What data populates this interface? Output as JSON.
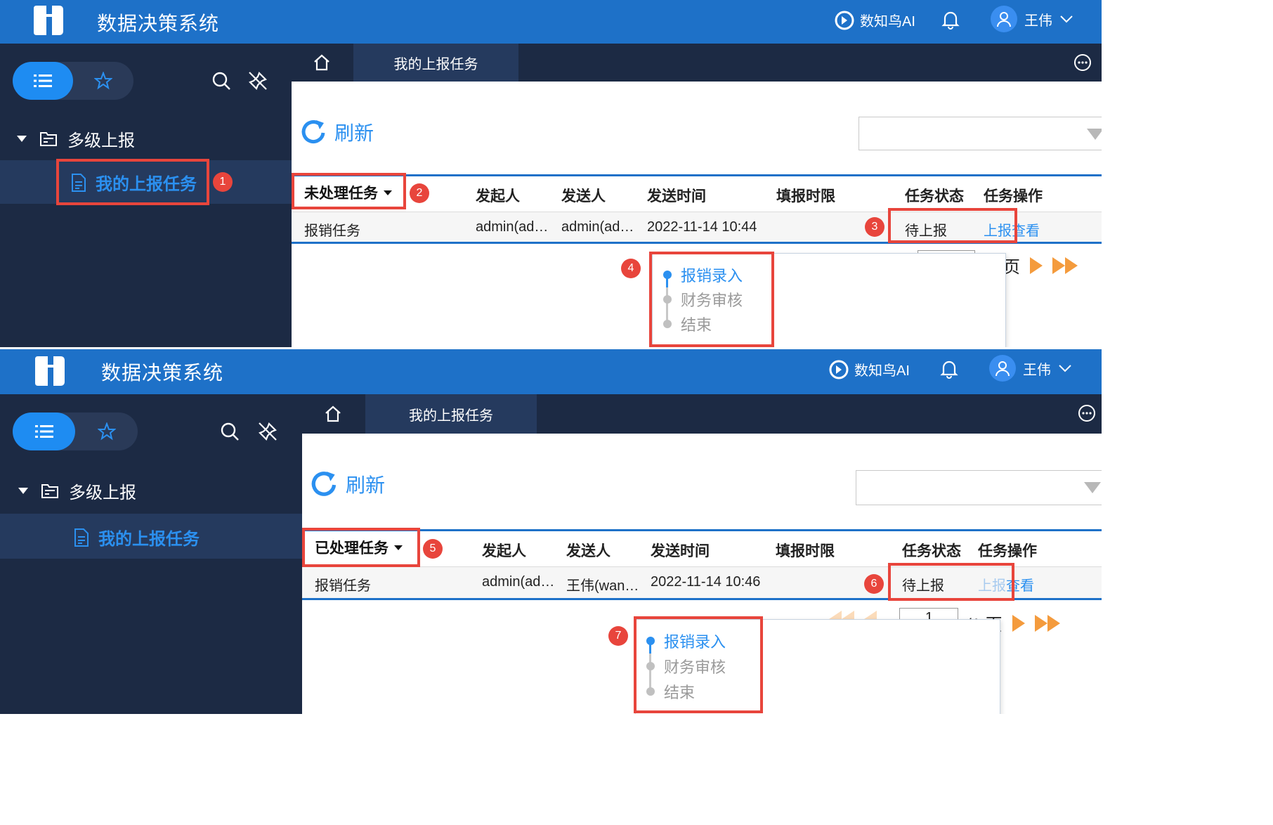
{
  "colors": {
    "topbar": "#1e71c8",
    "sidebar": "#1c2a44",
    "accent": "#2b90f0",
    "highlight": "#e8453c",
    "pager": "#f49b3d"
  },
  "panels": [
    {
      "app_title": "数据决策系统",
      "ai_label": "数知鸟AI",
      "user_name": "王伟",
      "tree_folder": "多级上报",
      "tree_item": "我的上报任务",
      "tab_label": "我的上报任务",
      "refresh_label": "刷新",
      "task_filter": "未处理任务",
      "columns": [
        "发起人",
        "发送人",
        "发送时间",
        "填报时限",
        "任务状态",
        "任务操作"
      ],
      "row": {
        "name": "报销任务",
        "initiator": "admin(ad…",
        "sender": "admin(ad…",
        "time": "2022-11-14 10:44",
        "deadline": "",
        "status": "待上报",
        "action_report": "上报",
        "action_view": "查看"
      },
      "pager_text": "页",
      "steps": [
        {
          "label": "报销录入",
          "state": "active"
        },
        {
          "label": "财务审核",
          "state": "inactive"
        },
        {
          "label": "结束",
          "state": "inactive"
        }
      ],
      "badges": [
        "1",
        "2",
        "3",
        "4"
      ]
    },
    {
      "app_title": "数据决策系统",
      "ai_label": "数知鸟AI",
      "user_name": "王伟",
      "tree_folder": "多级上报",
      "tree_item": "我的上报任务",
      "tab_label": "我的上报任务",
      "refresh_label": "刷新",
      "task_filter": "已处理任务",
      "columns": [
        "发起人",
        "发送人",
        "发送时间",
        "填报时限",
        "任务状态",
        "任务操作"
      ],
      "row": {
        "name": "报销任务",
        "initiator": "admin(ad…",
        "sender": "王伟(wan…",
        "time": "2022-11-14 10:46",
        "deadline": "",
        "status": "待上报",
        "action_report": "上报",
        "action_view": "查看"
      },
      "page_number": "1",
      "pager_text": "/1 页",
      "steps": [
        {
          "label": "报销录入",
          "state": "active"
        },
        {
          "label": "财务审核",
          "state": "inactive"
        },
        {
          "label": "结束",
          "state": "inactive"
        }
      ],
      "badges": [
        "5",
        "6",
        "7"
      ]
    }
  ],
  "icons": {
    "logo": "app-logo",
    "list": "list-icon",
    "star": "star-icon",
    "search": "search-icon",
    "unpin": "unpin-icon",
    "home": "home-icon",
    "more": "more-icon",
    "bell": "bell-icon",
    "ai": "ai-logo-icon",
    "user": "user-icon",
    "folder": "folder-icon",
    "doc": "document-icon",
    "refresh": "refresh-icon"
  }
}
